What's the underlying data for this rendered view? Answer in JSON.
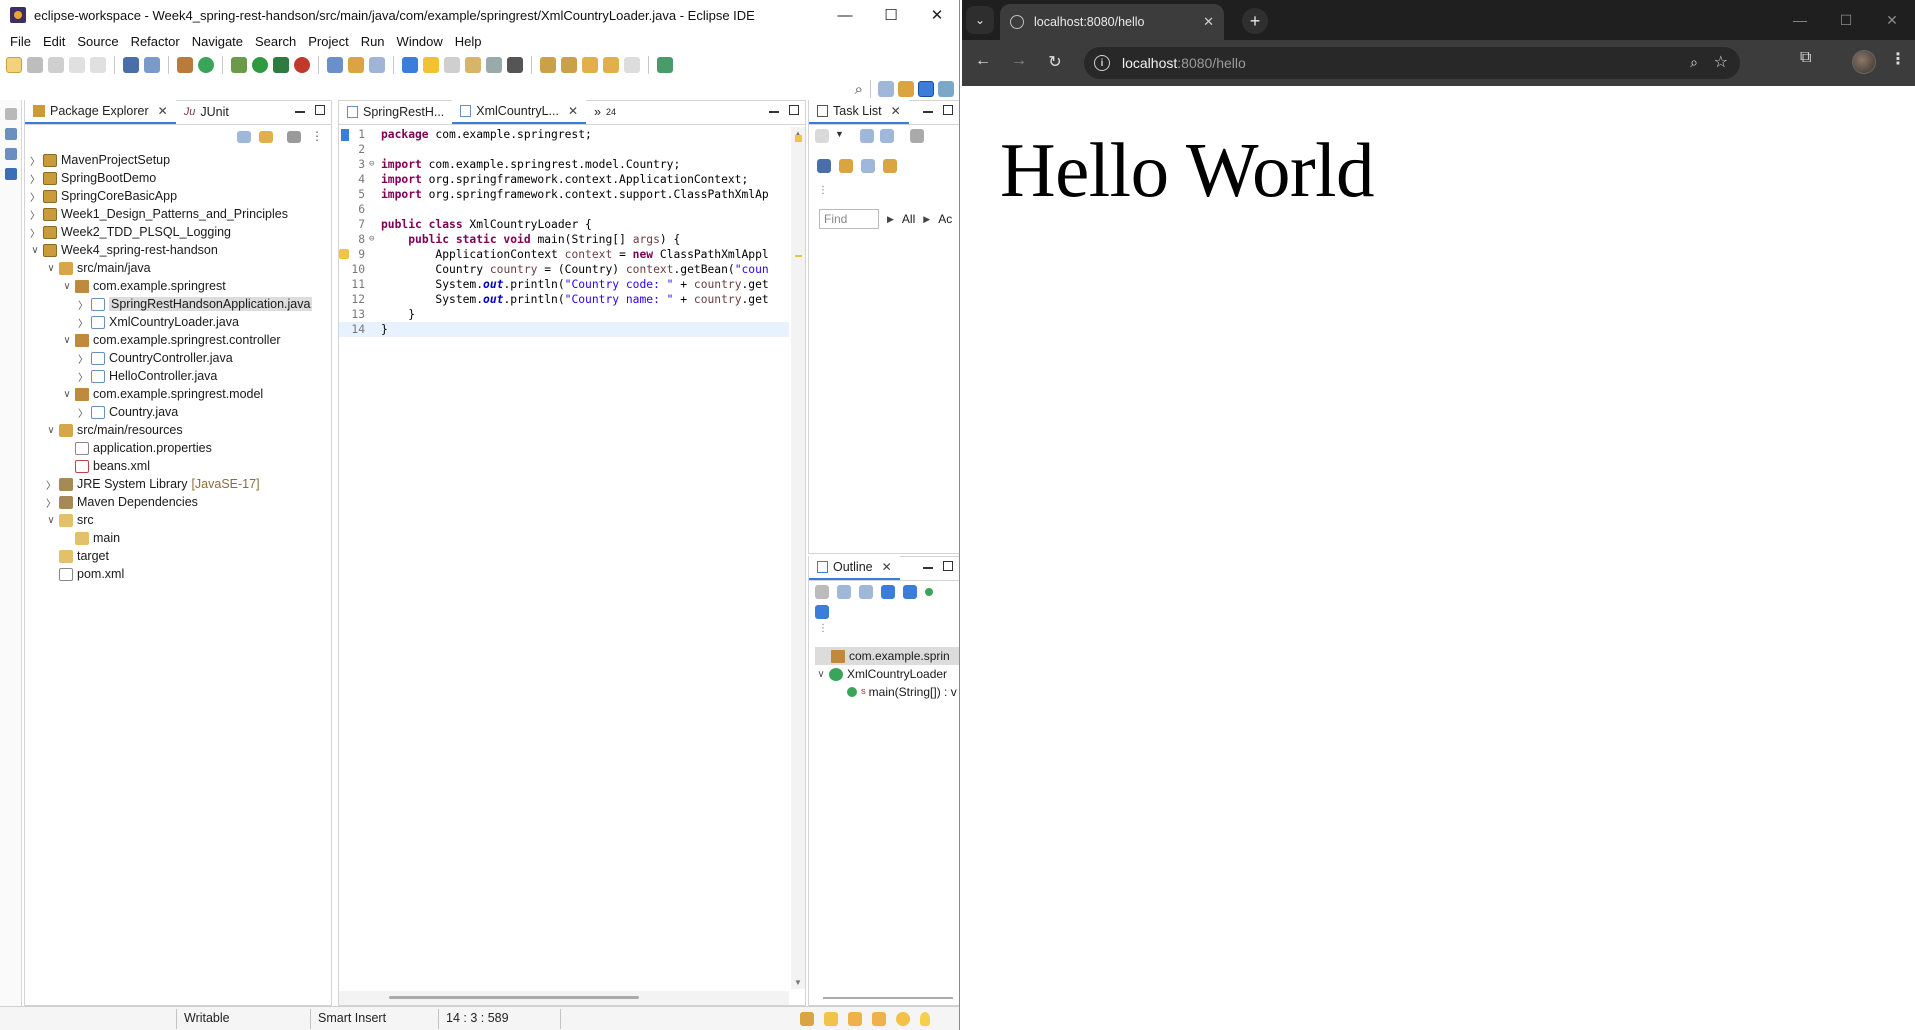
{
  "eclipse": {
    "title": "eclipse-workspace - Week4_spring-rest-handson/src/main/java/com/example/springrest/XmlCountryLoader.java - Eclipse IDE",
    "menu": [
      "File",
      "Edit",
      "Source",
      "Refactor",
      "Navigate",
      "Search",
      "Project",
      "Run",
      "Window",
      "Help"
    ],
    "package_explorer": {
      "tab_label": "Package Explorer",
      "junit_tab_label": "JUnit",
      "junit_prefix": "Ju",
      "tree": [
        {
          "label": "MavenProjectSetup"
        },
        {
          "label": "SpringBootDemo"
        },
        {
          "label": "SpringCoreBasicApp"
        },
        {
          "label": "Week1_Design_Patterns_and_Principles"
        },
        {
          "label": "Week2_TDD_PLSQL_Logging"
        },
        {
          "label": "Week4_spring-rest-handson"
        },
        {
          "label": "src/main/java"
        },
        {
          "label": "com.example.springrest"
        },
        {
          "label": "SpringRestHandsonApplication.java"
        },
        {
          "label": "XmlCountryLoader.java"
        },
        {
          "label": "com.example.springrest.controller"
        },
        {
          "label": "CountryController.java"
        },
        {
          "label": "HelloController.java"
        },
        {
          "label": "com.example.springrest.model"
        },
        {
          "label": "Country.java"
        },
        {
          "label": "src/main/resources"
        },
        {
          "label": "application.properties"
        },
        {
          "label": "beans.xml"
        },
        {
          "label": "JRE System Library",
          "decoration": "[JavaSE-17]"
        },
        {
          "label": "Maven Dependencies"
        },
        {
          "label": "src"
        },
        {
          "label": "main"
        },
        {
          "label": "target"
        },
        {
          "label": "pom.xml"
        }
      ]
    },
    "editor": {
      "tabs": [
        {
          "label": "SpringRestH..."
        },
        {
          "label": "XmlCountryL..."
        }
      ],
      "overflow_label": "»",
      "overflow_count": "24",
      "lines": [
        {
          "n": "1",
          "fold": ""
        },
        {
          "n": "2",
          "fold": ""
        },
        {
          "n": "3",
          "fold": "⊖"
        },
        {
          "n": "4",
          "fold": ""
        },
        {
          "n": "5",
          "fold": ""
        },
        {
          "n": "6",
          "fold": ""
        },
        {
          "n": "7",
          "fold": ""
        },
        {
          "n": "8",
          "fold": "⊖"
        },
        {
          "n": "9",
          "fold": ""
        },
        {
          "n": "10",
          "fold": ""
        },
        {
          "n": "11",
          "fold": ""
        },
        {
          "n": "12",
          "fold": ""
        },
        {
          "n": "13",
          "fold": ""
        },
        {
          "n": "14",
          "fold": ""
        }
      ],
      "code": {
        "l1_kw": "package",
        "l1_rest": " com.example.springrest;",
        "l3_kw": "import",
        "l3_rest": " com.example.springrest.model.Country;",
        "l4_kw": "import",
        "l4_rest": " org.springframework.context.ApplicationContext;",
        "l5_kw": "import",
        "l5_rest": " org.springframework.context.support.ClassPathXmlAp",
        "l7_kw": "public class",
        "l7_rest": " XmlCountryLoader {",
        "l8_kw": "public static void",
        "l8_rest1": " main(String[] ",
        "l8_var": "args",
        "l8_rest2": ") {",
        "l9_a": "ApplicationContext ",
        "l9_var": "context",
        "l9_b": " = ",
        "l9_kw": "new",
        "l9_c": " ClassPathXmlAppl",
        "l10_a": "Country ",
        "l10_var": "country",
        "l10_b": " = (Country) ",
        "l10_var2": "context",
        "l10_c": ".getBean(",
        "l10_str": "\"coun",
        "l11_a": "System.",
        "l11_fld": "out",
        "l11_b": ".println(",
        "l11_str": "\"Country code: \"",
        "l11_c": " + ",
        "l11_var": "country",
        "l11_d": ".get",
        "l12_a": "System.",
        "l12_fld": "out",
        "l12_b": ".println(",
        "l12_str": "\"Country name: \"",
        "l12_c": " + ",
        "l12_var": "country",
        "l12_d": ".get",
        "l13": "}",
        "l14": "}"
      }
    },
    "task_list": {
      "tab_label": "Task List",
      "find_placeholder": "Find",
      "filter_all": "All",
      "filter_ac": "Ac"
    },
    "outline": {
      "tab_label": "Outline",
      "items": [
        {
          "label": "com.example.sprin"
        },
        {
          "label": "XmlCountryLoader"
        },
        {
          "label": "main(String[]) : v",
          "superscript": "S"
        }
      ]
    },
    "status": {
      "writable": "Writable",
      "insert_mode": "Smart Insert",
      "position": "14 : 3 : 589"
    }
  },
  "browser": {
    "tab_title": "localhost:8080/hello",
    "url_host": "localhost",
    "url_path": ":8080/hello",
    "page_heading": "Hello World"
  },
  "colors": {
    "keyword": "#7f0055",
    "string": "#2a00ff",
    "browser_chrome": "#3c3c3c",
    "browser_tabstrip": "#1f1f1f"
  }
}
